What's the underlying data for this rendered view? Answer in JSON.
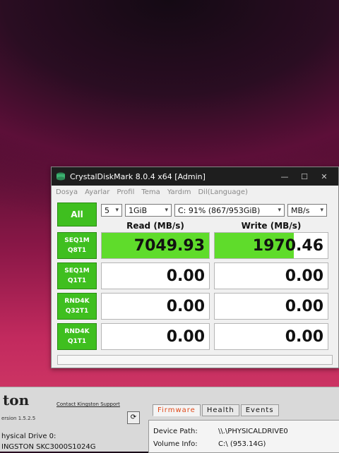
{
  "window": {
    "title": "CrystalDiskMark 8.0.4 x64 [Admin]",
    "controls": {
      "minimize": "—",
      "maximize": "☐",
      "close": "✕"
    }
  },
  "menu": [
    "Dosya",
    "Ayarlar",
    "Profil",
    "Tema",
    "Yardım",
    "Dil(Language)"
  ],
  "settings": {
    "count": "5",
    "size": "1GiB",
    "drive": "C: 91% (867/953GiB)",
    "unit": "MB/s"
  },
  "all_button": "All",
  "headers": {
    "read": "Read (MB/s)",
    "write": "Write (MB/s)"
  },
  "tests": [
    {
      "line1": "SEQ1M",
      "line2": "Q8T1",
      "read": "7049.93",
      "write": "1970.46",
      "read_fill": 1.0,
      "write_fill": 0.7
    },
    {
      "line1": "SEQ1M",
      "line2": "Q1T1",
      "read": "0.00",
      "write": "0.00",
      "read_fill": 0,
      "write_fill": 0
    },
    {
      "line1": "RND4K",
      "line2": "Q32T1",
      "read": "0.00",
      "write": "0.00",
      "read_fill": 0,
      "write_fill": 0
    },
    {
      "line1": "RND4K",
      "line2": "Q1T1",
      "read": "0.00",
      "write": "0.00",
      "read_fill": 0,
      "write_fill": 0
    }
  ],
  "kingston": {
    "logo": "ton",
    "version": "ersion 1.5.2.5",
    "contact": "Contact Kingston Support",
    "drive_line1": "hysical Drive 0:",
    "drive_line2": "INGSTON SKC3000S1024G",
    "tabs": [
      "Firmware",
      "Health",
      "Events"
    ],
    "device_path_label": "Device Path:",
    "device_path_value": "\\\\.\\PHYSICALDRIVE0",
    "volume_info_label": "Volume Info:",
    "volume_info_value": "C:\\ (953.14G)"
  },
  "colors": {
    "accent_green": "#3fbf1f",
    "bar_fill": "#5fdc2b",
    "active_tab": "#e04a1a"
  }
}
